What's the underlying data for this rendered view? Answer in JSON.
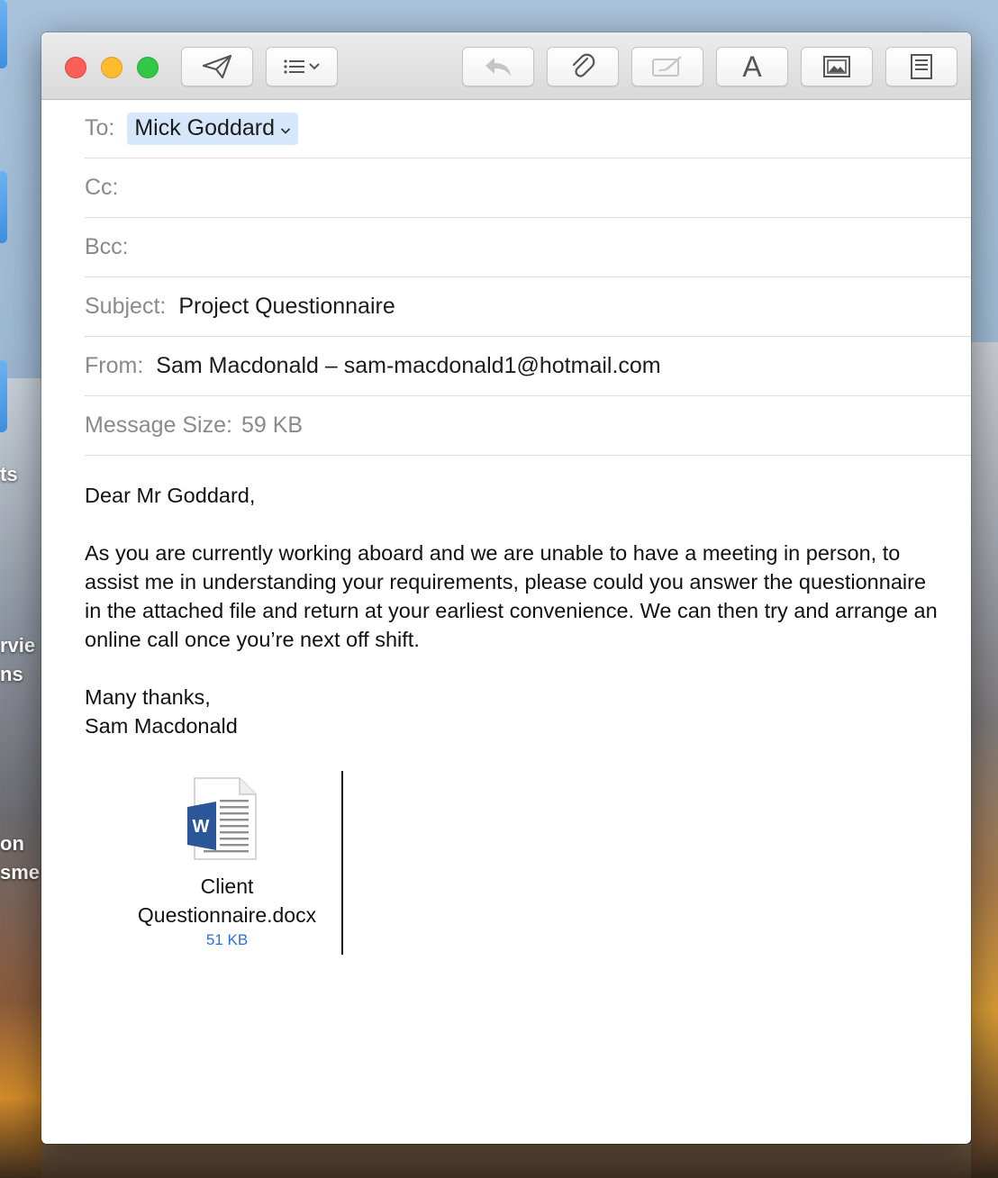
{
  "desktop": {
    "labels": [
      "ts",
      "rvie",
      "ns",
      "on",
      "sme"
    ]
  },
  "toolbar": {
    "buttons": [
      {
        "name": "send",
        "icon": "paper-plane-icon"
      },
      {
        "name": "header-fields",
        "icon": "list-chevron-icon"
      },
      {
        "name": "reply",
        "icon": "reply-arrow-icon",
        "disabled": true
      },
      {
        "name": "attach",
        "icon": "paperclip-icon"
      },
      {
        "name": "markup",
        "icon": "markup-icon",
        "disabled": true
      },
      {
        "name": "format",
        "icon": "font-a-icon",
        "label": "A"
      },
      {
        "name": "photo-browser",
        "icon": "photo-icon"
      },
      {
        "name": "stationery",
        "icon": "stationery-icon"
      }
    ]
  },
  "header": {
    "to_label": "To:",
    "to_recipient": "Mick Goddard",
    "cc_label": "Cc:",
    "bcc_label": "Bcc:",
    "subject_label": "Subject:",
    "subject_value": "Project Questionnaire",
    "from_label": "From:",
    "from_value": "Sam Macdonald – sam-macdonald1@hotmail.com",
    "size_label": "Message Size:",
    "size_value": "59 KB"
  },
  "body": {
    "greeting": "Dear Mr Goddard,",
    "paragraph": "As you are currently working aboard and we are unable to have a meeting in person, to assist me in understanding your requirements, please could you answer the questionnaire in the attached file and return at your earliest convenience. We can then try and arrange an online call once you’re next off shift.",
    "signoff": "Many thanks,",
    "signature": "Sam Macdonald"
  },
  "attachment": {
    "name_line1": "Client",
    "name_line2": "Questionnaire.docx",
    "size": "51 KB",
    "icon": "word-document-icon",
    "badge": "W"
  },
  "colors": {
    "recipient_chip": "#d6e6fb",
    "attachment_size": "#2f6fd6",
    "word_blue": "#2b579a",
    "close": "#fc5f57",
    "minimize": "#fdbc2e",
    "zoom": "#33c748"
  }
}
